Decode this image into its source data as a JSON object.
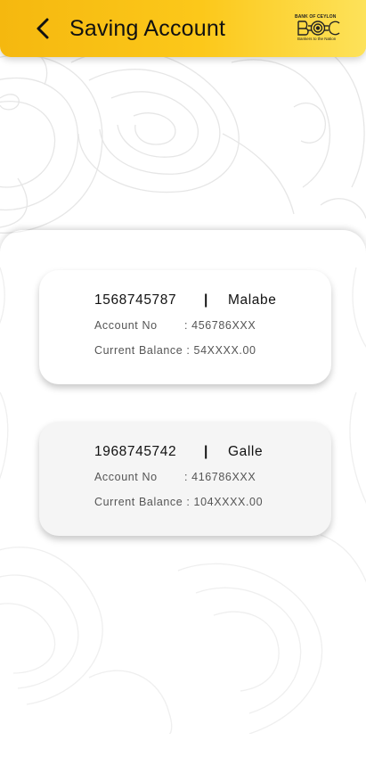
{
  "header": {
    "title": "Saving Account",
    "logo": {
      "bank_name": "BANK OF CEYLON",
      "mark": "BOC",
      "tagline": "Bankers to the Nation"
    },
    "color_start": "#f5b80f",
    "color_end": "#fde25a"
  },
  "accounts": [
    {
      "number": "1568745787",
      "separator": "|",
      "branch": "Malabe",
      "account_no_label": "Account No",
      "account_no_value": ": 456786XXX",
      "balance_label": "Current Balance",
      "balance_value": ": 54XXXX.00"
    },
    {
      "number": "1968745742",
      "separator": "|",
      "branch": "Galle",
      "account_no_label": "Account No",
      "account_no_value": ": 416786XXX",
      "balance_label": "Current Balance",
      "balance_value": ": 104XXXX.00"
    }
  ]
}
